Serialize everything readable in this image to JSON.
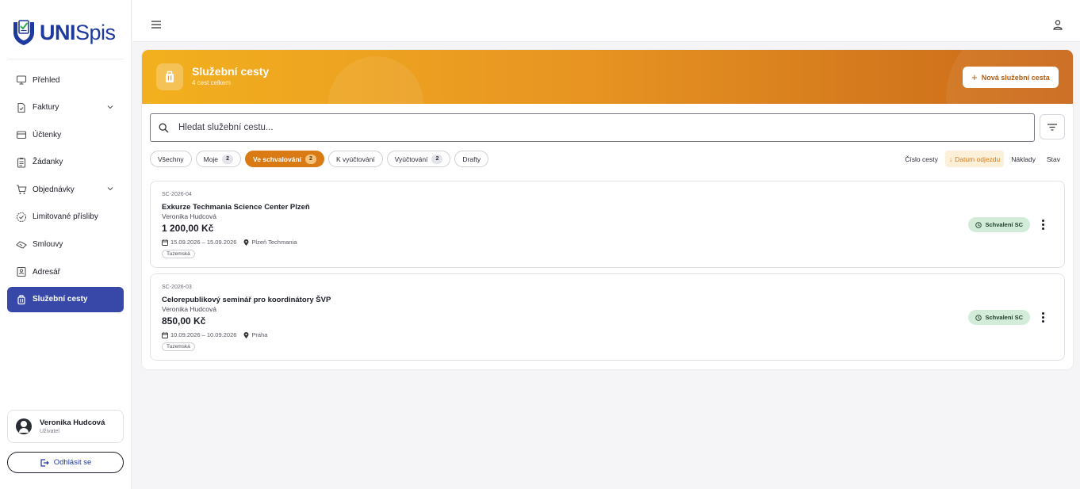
{
  "app": {
    "logo_bold": "UNI",
    "logo_light": "Spis"
  },
  "sidebar": {
    "items": [
      {
        "label": "Přehled",
        "icon": "monitor-icon"
      },
      {
        "label": "Faktury",
        "icon": "invoice-icon",
        "expandable": true
      },
      {
        "label": "Účtenky",
        "icon": "wallet-icon"
      },
      {
        "label": "Žádanky",
        "icon": "clipboard-icon"
      },
      {
        "label": "Objednávky",
        "icon": "cart-icon",
        "expandable": true
      },
      {
        "label": "Limitované přísliby",
        "icon": "badge-check-icon"
      },
      {
        "label": "Smlouvy",
        "icon": "handshake-icon"
      },
      {
        "label": "Adresář",
        "icon": "contact-card-icon"
      },
      {
        "label": "Služební cesty",
        "icon": "luggage-icon",
        "active": true
      }
    ],
    "user": {
      "name": "Veronika Hudcová",
      "role": "Uživatel"
    },
    "logout_label": "Odhlásit se"
  },
  "header": {
    "title": "Služební cesty",
    "subtitle": "4 cest celkem",
    "new_button": "Nová služební cesta"
  },
  "search": {
    "placeholder": "Hledat služební cestu..."
  },
  "filters": [
    {
      "label": "Všechny",
      "count": null,
      "active": false
    },
    {
      "label": "Moje",
      "count": "2",
      "active": false
    },
    {
      "label": "Ve schvalování",
      "count": "2",
      "active": true
    },
    {
      "label": "K vyúčtování",
      "count": null,
      "active": false
    },
    {
      "label": "Vyúčtování",
      "count": "2",
      "active": false
    },
    {
      "label": "Drafty",
      "count": null,
      "active": false
    }
  ],
  "sort": {
    "options": [
      {
        "label": "Číslo cesty",
        "active": false
      },
      {
        "label": "Datum odjezdu",
        "active": true,
        "arrow": "↓"
      },
      {
        "label": "Náklady",
        "active": false
      },
      {
        "label": "Stav",
        "active": false
      }
    ]
  },
  "trips": [
    {
      "id": "SC-2026-04",
      "name": "Exkurze Techmania Science Center Plzeň",
      "person": "Veronika Hudcová",
      "price": "1 200,00 Kč",
      "dates": "15.09.2026 – 15.09.2026",
      "place": "Plzeň Techmania",
      "tag": "Tuzemská",
      "status": "Schvalení SC"
    },
    {
      "id": "SC-2026-03",
      "name": "Celorepublikový seminář pro koordinátory ŠVP",
      "person": "Veronika Hudcová",
      "price": "850,00 Kč",
      "dates": "10.09.2026 – 10.09.2026",
      "place": "Praha",
      "tag": "Tuzemská",
      "status": "Schvalení SC"
    }
  ],
  "colors": {
    "brand_blue": "#1f3a9e",
    "active_nav": "#3848a8",
    "accent_orange": "#d97a14",
    "status_green_bg": "#d3ecd9"
  }
}
